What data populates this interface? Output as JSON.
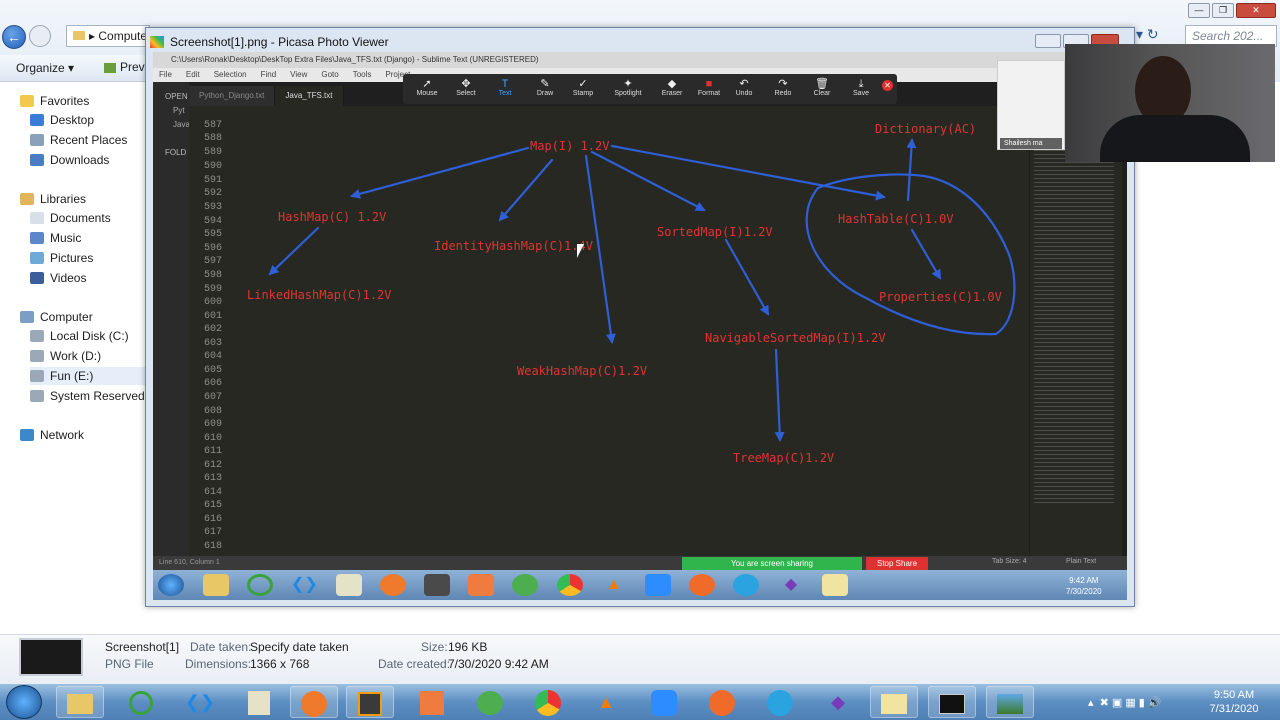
{
  "explorer": {
    "address": "Computer",
    "search_placeholder": "Search 202...",
    "organize_label": "Organize",
    "preview_label": "Previ",
    "favorites_header": "Favorites",
    "favorites": [
      "Desktop",
      "Recent Places",
      "Downloads"
    ],
    "libraries_header": "Libraries",
    "libraries": [
      "Documents",
      "Music",
      "Pictures",
      "Videos"
    ],
    "computer_header": "Computer",
    "drives": [
      "Local Disk (C:)",
      "Work (D:)",
      "Fun (E:)",
      "System Reserved (H"
    ],
    "network_label": "Network"
  },
  "picasa": {
    "title": "Screenshot[1].png - Picasa Photo Viewer"
  },
  "sublime": {
    "window_title": "C:\\Users\\Ronak\\Desktop\\DeskTop Extra Files\\Java_TFS.txt (Django) - Sublime Text (UNREGISTERED)",
    "menu": [
      "File",
      "Edit",
      "Selection",
      "Find",
      "View",
      "Goto",
      "Tools",
      "Project"
    ],
    "sidebar_labels": [
      "OPEN",
      "Pyt",
      "Java",
      "FOLD"
    ],
    "tabs": [
      "Python_Django.txt",
      "Java_TFS.txt"
    ],
    "line_numbers": [
      "587",
      "588",
      "589",
      "590",
      "591",
      "592",
      "593",
      "594",
      "595",
      "596",
      "597",
      "598",
      "599",
      "600",
      "601",
      "602",
      "603",
      "604",
      "605",
      "606",
      "607",
      "608",
      "609",
      "610",
      "611",
      "612",
      "613",
      "614",
      "615",
      "616",
      "617",
      "618"
    ],
    "status_left": "Line 610, Column 1",
    "tab_size": "Tab Size: 4",
    "syntax": "Plain Text",
    "inner_clock_time": "9:42 AM",
    "inner_clock_date": "7/30/2020"
  },
  "zoom": {
    "tools": [
      "Mouse",
      "Select",
      "Text",
      "Draw",
      "Stamp",
      "Spotlight",
      "Eraser",
      "Format",
      "Undo",
      "Redo",
      "Clear",
      "Save"
    ],
    "sharing_text": "You are screen sharing",
    "stop_share": "Stop Share",
    "participant_name": "Shailesh ma"
  },
  "diagram": {
    "map": "Map(I) 1.2V",
    "hashmap": "HashMap(C) 1.2V",
    "identityhashmap": "IdentityHashMap(C)1.4V",
    "sortedmap": "SortedMap(I)1.2V",
    "hashtable": "HashTable(C)1.0V",
    "dictionary": "Dictionary(AC)",
    "linkedhashmap": "LinkedHashMap(C)1.2V",
    "weakhashmap": "WeakHashMap(C)1.2V",
    "navigablesortedmap": "NavigableSortedMap(I)1.2V",
    "properties": "Properties(C)1.0V",
    "treemap": "TreeMap(C)1.2V",
    "arrow_color": "#2f5fd6",
    "label_color": "#e23333"
  },
  "info": {
    "name": "Screenshot[1]",
    "type": "PNG File",
    "date_taken_label": "Date taken:",
    "date_taken": "Specify date taken",
    "dimensions_label": "Dimensions:",
    "dimensions": "1366 x 768",
    "size_label": "Size:",
    "size": "196 KB",
    "date_created_label": "Date created:",
    "date_created": "7/30/2020 9:42 AM"
  },
  "taskbar": {
    "time": "9:50 AM",
    "date": "7/31/2020"
  }
}
